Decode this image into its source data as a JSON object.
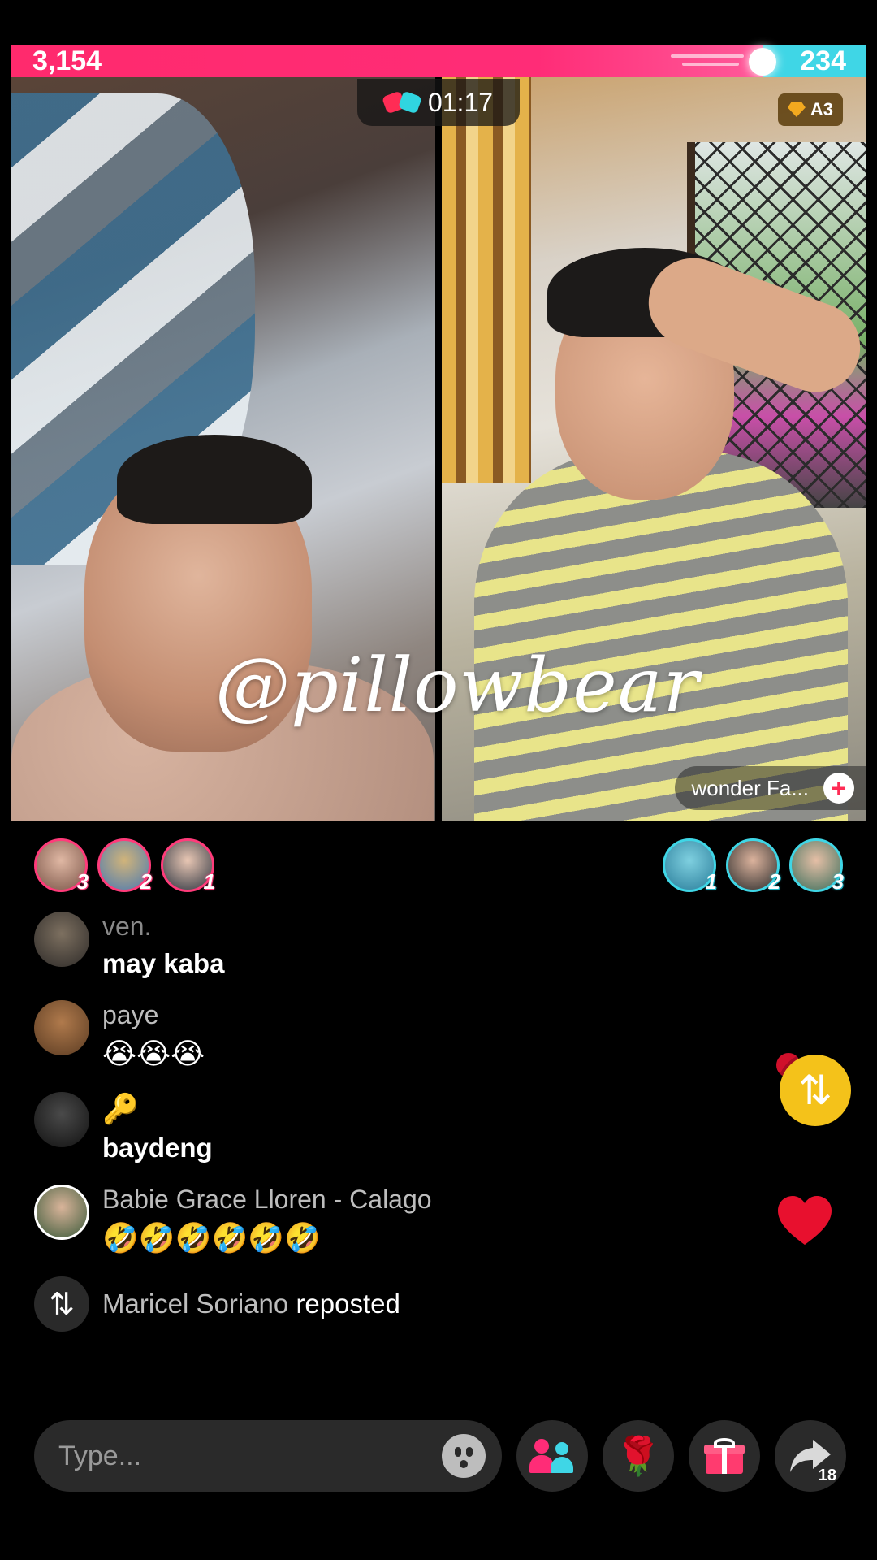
{
  "battle": {
    "left_score": "3,154",
    "right_score": "234",
    "timer": "01:17",
    "rank_badge": "A3",
    "left_share": 0.88
  },
  "cohost": {
    "name": "wonder Fa...",
    "follow_icon": "plus-icon"
  },
  "watermark": "@pillowbear",
  "gifters_left": [
    {
      "rank": "3"
    },
    {
      "rank": "2"
    },
    {
      "rank": "1"
    }
  ],
  "gifters_right": [
    {
      "rank": "1"
    },
    {
      "rank": "2"
    },
    {
      "rank": "3"
    }
  ],
  "comments": [
    {
      "user": "ven.",
      "text": "may kaba"
    },
    {
      "user": "paye",
      "emoji": "😭😭😭"
    },
    {
      "user": "🔑",
      "text": "baydeng"
    },
    {
      "user": "Babie Grace Lloren - Calago",
      "emoji": "🤣🤣🤣🤣🤣🤣"
    }
  ],
  "repost_event": {
    "user": "Maricel Soriano",
    "action": "reposted"
  },
  "input": {
    "placeholder": "Type..."
  },
  "toolbar": {
    "share_count": "18"
  },
  "colors": {
    "left_team": "#ff2c77",
    "right_team": "#3fd6e6",
    "repost_button": "#f4c21a",
    "heart": "#e8102e"
  }
}
